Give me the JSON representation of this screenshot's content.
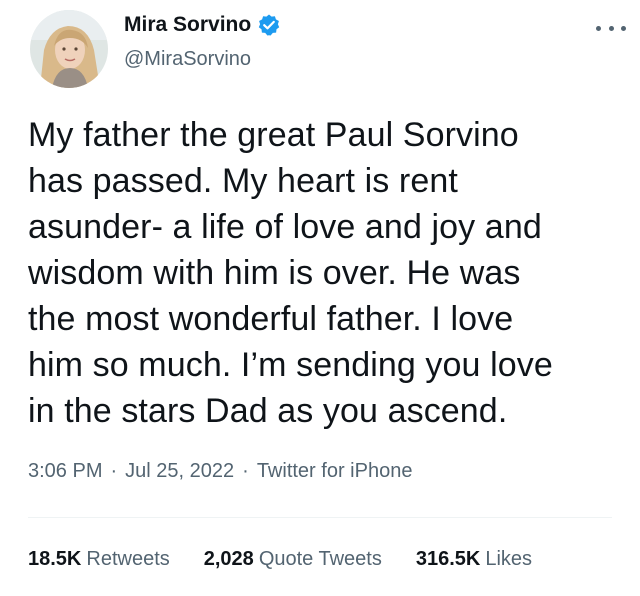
{
  "author": {
    "display_name": "Mira Sorvino",
    "handle": "@MiraSorvino",
    "verified_icon": "verified-badge-icon",
    "avatar_icon": "profile-avatar"
  },
  "tweet": {
    "text": "My father the great Paul Sorvino\nhas passed. My heart is rent\nasunder- a life of love and joy and\nwisdom with him is over. He was\nthe most wonderful father. I love\nhim so much. I’m sending you love\nin the stars Dad as you ascend."
  },
  "meta": {
    "time": "3:06 PM",
    "sep1": "·",
    "date": "Jul 25, 2022",
    "sep2": "·",
    "source": "Twitter for iPhone"
  },
  "stats": {
    "retweets_count": "18.5K",
    "retweets_label": "Retweets",
    "quotes_count": "2,028",
    "quotes_label": "Quote Tweets",
    "likes_count": "316.5K",
    "likes_label": "Likes"
  },
  "colors": {
    "text_primary": "#0f1419",
    "text_secondary": "#536471",
    "verified_blue": "#1d9bf0",
    "divider": "#eff3f4"
  },
  "icons": {
    "more": "more-options-icon"
  }
}
